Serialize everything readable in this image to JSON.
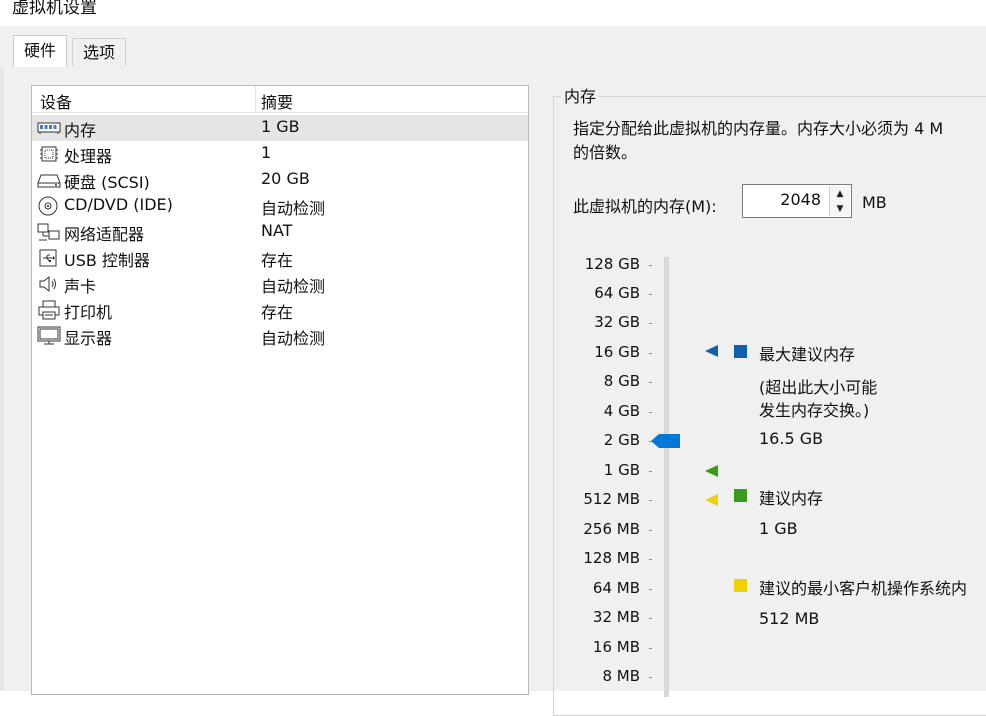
{
  "window": {
    "title": "虚拟机设置"
  },
  "tabs": [
    {
      "label": "硬件"
    },
    {
      "label": "选项"
    }
  ],
  "device_list": {
    "headers": {
      "device": "设备",
      "summary": "摘要"
    },
    "rows": [
      {
        "icon": "memory-icon",
        "name": "内存",
        "summary": "1 GB",
        "selected": true
      },
      {
        "icon": "processor-icon",
        "name": "处理器",
        "summary": "1"
      },
      {
        "icon": "hard-disk-icon",
        "name": "硬盘 (SCSI)",
        "summary": "20 GB"
      },
      {
        "icon": "cd-dvd-icon",
        "name": "CD/DVD (IDE)",
        "summary": "自动检测"
      },
      {
        "icon": "network-adapter-icon",
        "name": "网络适配器",
        "summary": "NAT"
      },
      {
        "icon": "usb-icon",
        "name": "USB 控制器",
        "summary": "存在"
      },
      {
        "icon": "sound-card-icon",
        "name": "声卡",
        "summary": "自动检测"
      },
      {
        "icon": "printer-icon",
        "name": "打印机",
        "summary": "存在"
      },
      {
        "icon": "display-icon",
        "name": "显示器",
        "summary": "自动检测"
      }
    ]
  },
  "memory": {
    "group_title": "内存",
    "description_line1": "指定分配给此虚拟机的内存量。内存大小必须为 4 M",
    "description_line2": "的倍数。",
    "field_label": "此虚拟机的内存(M):",
    "value": "2048",
    "unit": "MB",
    "scale": [
      "128 GB",
      "64 GB",
      "32 GB",
      "16 GB",
      "8 GB",
      "4 GB",
      "2 GB",
      "1 GB",
      "512 MB",
      "256 MB",
      "128 MB",
      "64 MB",
      "32 MB",
      "16 MB",
      "8 MB"
    ],
    "slider_value": "2 GB",
    "legend": {
      "max": {
        "label": "最大建议内存",
        "note_line1": "(超出此大小可能",
        "note_line2": "发生内存交换。)",
        "value": "16.5 GB",
        "color": "#1060b0"
      },
      "recommended": {
        "label": "建议内存",
        "value": "1 GB",
        "color": "#3a9a1a"
      },
      "min_os": {
        "label": "建议的最小客户机操作系统内",
        "value": "512 MB",
        "color": "#f0d000"
      }
    },
    "accent_color": "#0078d7"
  }
}
